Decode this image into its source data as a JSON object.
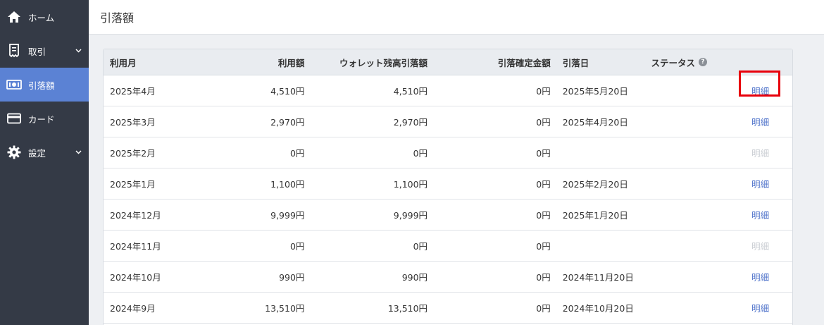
{
  "sidebar": {
    "items": [
      {
        "label": "ホーム",
        "icon": "home-icon",
        "active": false,
        "chevron": false
      },
      {
        "label": "取引",
        "icon": "receipt-icon",
        "active": false,
        "chevron": true
      },
      {
        "label": "引落額",
        "icon": "money-icon",
        "active": true,
        "chevron": false
      },
      {
        "label": "カード",
        "icon": "credit-card-icon",
        "active": false,
        "chevron": false
      },
      {
        "label": "設定",
        "icon": "gear-icon",
        "active": false,
        "chevron": true
      }
    ]
  },
  "header": {
    "title": "引落額"
  },
  "table": {
    "headers": {
      "month": "利用月",
      "amount": "利用額",
      "wallet": "ウォレット残高引落額",
      "fixed": "引落確定金額",
      "date": "引落日",
      "status": "ステータス",
      "status_help_icon": "help-icon"
    },
    "detail_label": "明細",
    "rows": [
      {
        "month": "2025年4月",
        "amount": "4,510円",
        "wallet": "4,510円",
        "fixed": "0円",
        "date": "2025年5月20日",
        "status": "",
        "detail": "明細",
        "detail_enabled": true,
        "highlighted": true
      },
      {
        "month": "2025年3月",
        "amount": "2,970円",
        "wallet": "2,970円",
        "fixed": "0円",
        "date": "2025年4月20日",
        "status": "",
        "detail": "明細",
        "detail_enabled": true,
        "highlighted": false
      },
      {
        "month": "2025年2月",
        "amount": "0円",
        "wallet": "0円",
        "fixed": "0円",
        "date": "",
        "status": "",
        "detail": "明細",
        "detail_enabled": false,
        "highlighted": false
      },
      {
        "month": "2025年1月",
        "amount": "1,100円",
        "wallet": "1,100円",
        "fixed": "0円",
        "date": "2025年2月20日",
        "status": "",
        "detail": "明細",
        "detail_enabled": true,
        "highlighted": false
      },
      {
        "month": "2024年12月",
        "amount": "9,999円",
        "wallet": "9,999円",
        "fixed": "0円",
        "date": "2025年1月20日",
        "status": "",
        "detail": "明細",
        "detail_enabled": true,
        "highlighted": false
      },
      {
        "month": "2024年11月",
        "amount": "0円",
        "wallet": "0円",
        "fixed": "0円",
        "date": "",
        "status": "",
        "detail": "明細",
        "detail_enabled": false,
        "highlighted": false
      },
      {
        "month": "2024年10月",
        "amount": "990円",
        "wallet": "990円",
        "fixed": "0円",
        "date": "2024年11月20日",
        "status": "",
        "detail": "明細",
        "detail_enabled": true,
        "highlighted": false
      },
      {
        "month": "2024年9月",
        "amount": "13,510円",
        "wallet": "13,510円",
        "fixed": "0円",
        "date": "2024年10月20日",
        "status": "",
        "detail": "明細",
        "detail_enabled": true,
        "highlighted": false
      }
    ]
  },
  "colors": {
    "sidebar_bg": "#343a46",
    "sidebar_active": "#5b82d4",
    "link": "#4a6fc9",
    "link_disabled": "#c8ccd2",
    "highlight_border": "#e8000b"
  }
}
